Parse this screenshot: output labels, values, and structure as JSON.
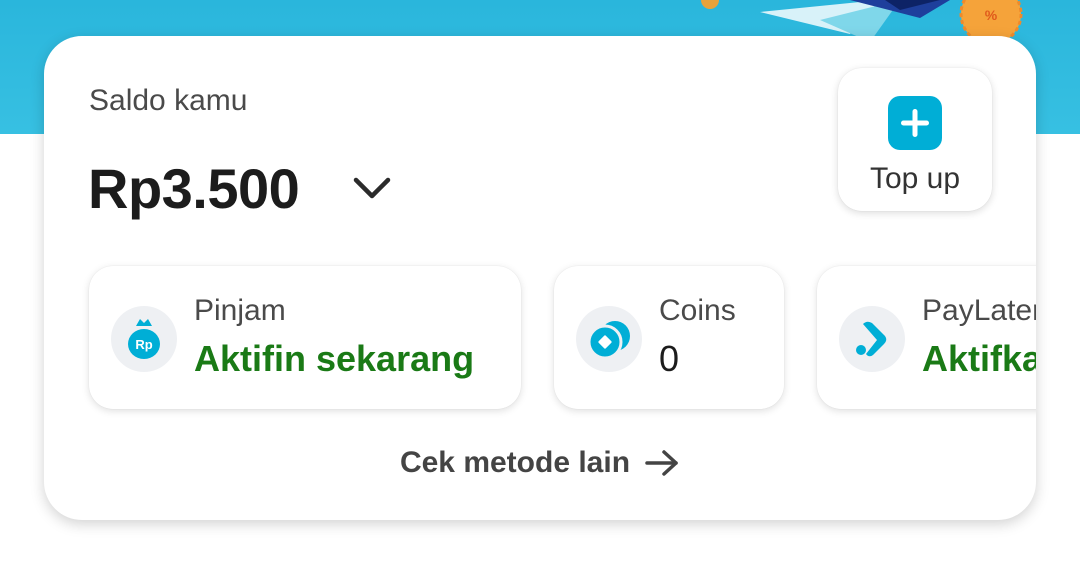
{
  "balance_card": {
    "label": "Saldo kamu",
    "amount": "Rp3.500"
  },
  "topup": {
    "label": "Top up"
  },
  "methods": [
    {
      "title": "Pinjam",
      "value": "Aktifin sekarang",
      "icon": "money-bag-rp-icon"
    },
    {
      "title": "Coins",
      "value": "0",
      "icon": "coins-icon"
    },
    {
      "title": "PayLater",
      "value": "Aktifkan",
      "icon": "paylater-icon"
    }
  ],
  "footer": {
    "cek_label": "Cek metode lain"
  },
  "colors": {
    "accent": "#00aed6",
    "banner": "#33bde0",
    "success_green": "#1a7a16"
  }
}
